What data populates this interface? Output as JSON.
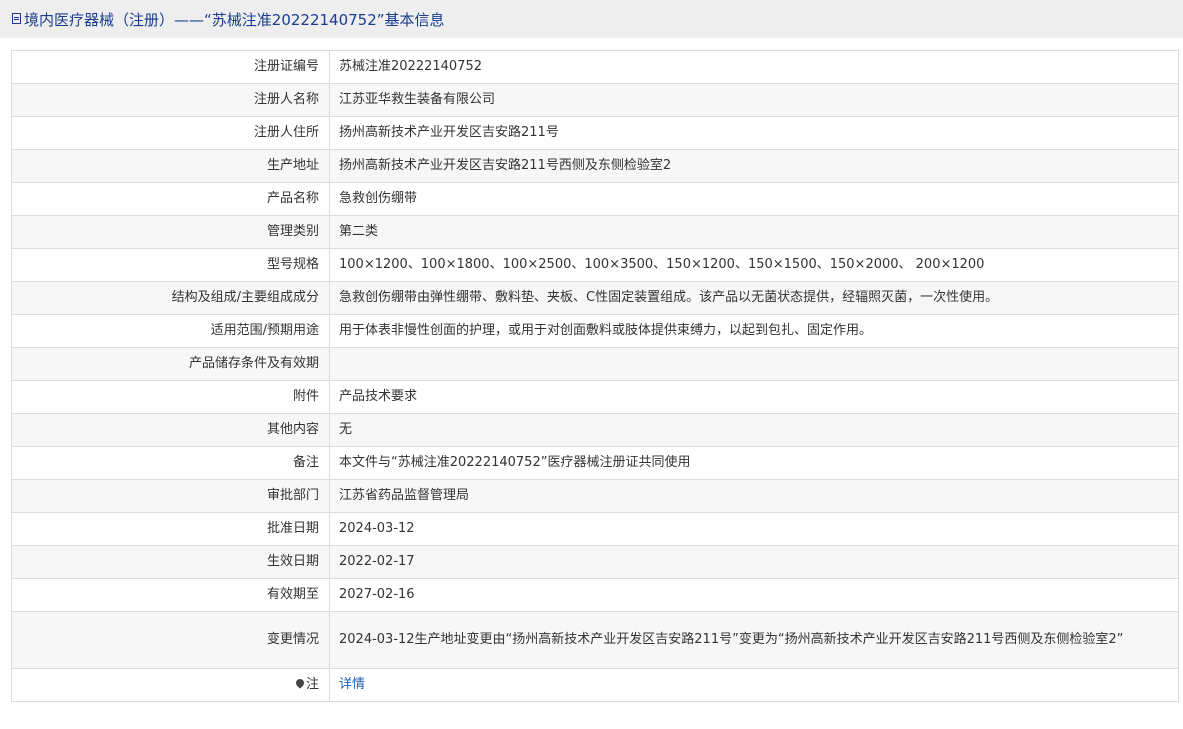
{
  "header": {
    "title": "境内医疗器械（注册）——“苏械注准20222140752”基本信息"
  },
  "rows": [
    {
      "label": "注册证编号",
      "value": "苏械注准20222140752"
    },
    {
      "label": "注册人名称",
      "value": "江苏亚华救生装备有限公司"
    },
    {
      "label": "注册人住所",
      "value": "扬州高新技术产业开发区吉安路211号"
    },
    {
      "label": "生产地址",
      "value": "扬州高新技术产业开发区吉安路211号西侧及东侧检验室2"
    },
    {
      "label": "产品名称",
      "value": "急救创伤绷带"
    },
    {
      "label": "管理类别",
      "value": "第二类"
    },
    {
      "label": "型号规格",
      "value": "100×1200、100×1800、100×2500、100×3500、150×1200、150×1500、150×2000、 200×1200"
    },
    {
      "label": "结构及组成/主要组成成分",
      "value": "急救创伤绷带由弹性绷带、敷料垫、夹板、C性固定装置组成。该产品以无菌状态提供，经辐照灭菌，一次性使用。"
    },
    {
      "label": "适用范围/预期用途",
      "value": "用于体表非慢性创面的护理，或用于对创面敷料或肢体提供束缚力，以起到包扎、固定作用。"
    },
    {
      "label": "产品储存条件及有效期",
      "value": ""
    },
    {
      "label": "附件",
      "value": "产品技术要求"
    },
    {
      "label": "其他内容",
      "value": "无"
    },
    {
      "label": "备注",
      "value": "本文件与“苏械注准20222140752”医疗器械注册证共同使用"
    },
    {
      "label": "审批部门",
      "value": "江苏省药品监督管理局"
    },
    {
      "label": "批准日期",
      "value": "2024-03-12"
    },
    {
      "label": "生效日期",
      "value": "2022-02-17"
    },
    {
      "label": "有效期至",
      "value": "2027-02-16"
    },
    {
      "label": "变更情况",
      "value": "2024-03-12生产地址变更由“扬州高新技术产业开发区吉安路211号”变更为“扬州高新技术产业开发区吉安路211号西侧及东侧检验室2”"
    }
  ],
  "note": {
    "label": "注",
    "icon": "pin-icon",
    "link_text": "详情"
  },
  "colors": {
    "header_text": "#1a3d8f",
    "link": "#1a5fb4",
    "border": "#dcdcdc"
  }
}
